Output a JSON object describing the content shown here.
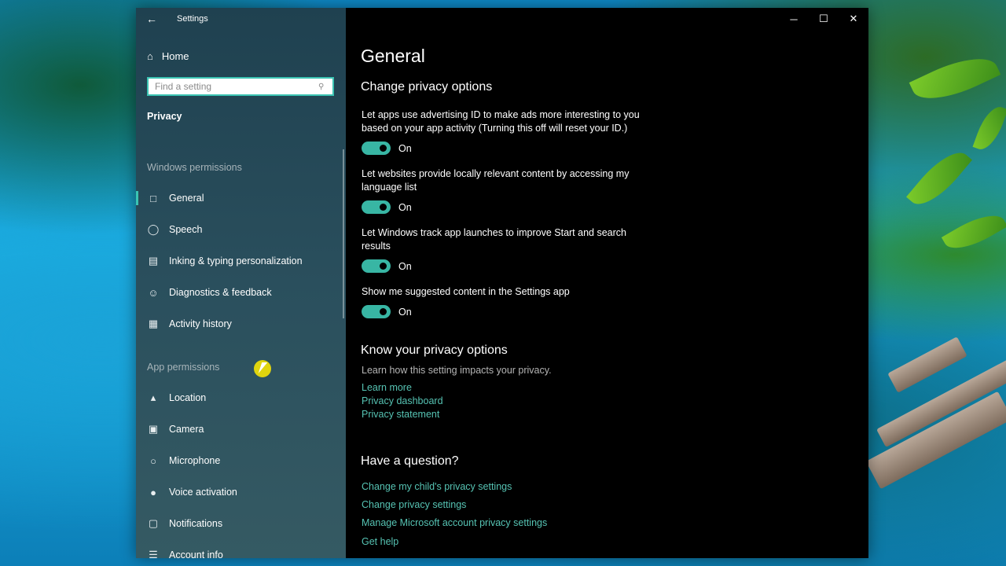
{
  "window": {
    "title": "Settings",
    "controls": {
      "minimize": "─",
      "maximize": "☐",
      "close": "✕"
    }
  },
  "sidebar": {
    "home_label": "Home",
    "search_placeholder": "Find a setting",
    "section_title": "Privacy",
    "windows_permissions_label": "Windows permissions",
    "windows_items": [
      {
        "label": "General",
        "icon": "lock-icon"
      },
      {
        "label": "Speech",
        "icon": "speech-icon"
      },
      {
        "label": "Inking & typing personalization",
        "icon": "notepad-icon"
      },
      {
        "label": "Diagnostics & feedback",
        "icon": "feedback-icon"
      },
      {
        "label": "Activity history",
        "icon": "history-icon"
      }
    ],
    "app_permissions_label": "App permissions",
    "app_items": [
      {
        "label": "Location",
        "icon": "location-icon"
      },
      {
        "label": "Camera",
        "icon": "camera-icon"
      },
      {
        "label": "Microphone",
        "icon": "microphone-icon"
      },
      {
        "label": "Voice activation",
        "icon": "voice-icon"
      },
      {
        "label": "Notifications",
        "icon": "notifications-icon"
      },
      {
        "label": "Account info",
        "icon": "account-icon"
      }
    ]
  },
  "main": {
    "page_title": "General",
    "change_heading": "Change privacy options",
    "options": [
      {
        "text": "Let apps use advertising ID to make ads more interesting to you based on your app activity (Turning this off will reset your ID.)",
        "state": "On"
      },
      {
        "text": "Let websites provide locally relevant content by accessing my language list",
        "state": "On"
      },
      {
        "text": "Let Windows track app launches to improve Start and search results",
        "state": "On"
      },
      {
        "text": "Show me suggested content in the Settings app",
        "state": "On"
      }
    ],
    "know_heading": "Know your privacy options",
    "know_desc": "Learn how this setting impacts your privacy.",
    "know_links": [
      "Learn more",
      "Privacy dashboard",
      "Privacy statement"
    ],
    "question_heading": "Have a question?",
    "question_links": [
      "Change my child's privacy settings",
      "Change privacy settings",
      "Manage Microsoft account privacy settings",
      "Get help"
    ]
  },
  "colors": {
    "accent": "#3bc4b3",
    "toggle_on": "#38b6a4",
    "link": "#56c3b3"
  }
}
